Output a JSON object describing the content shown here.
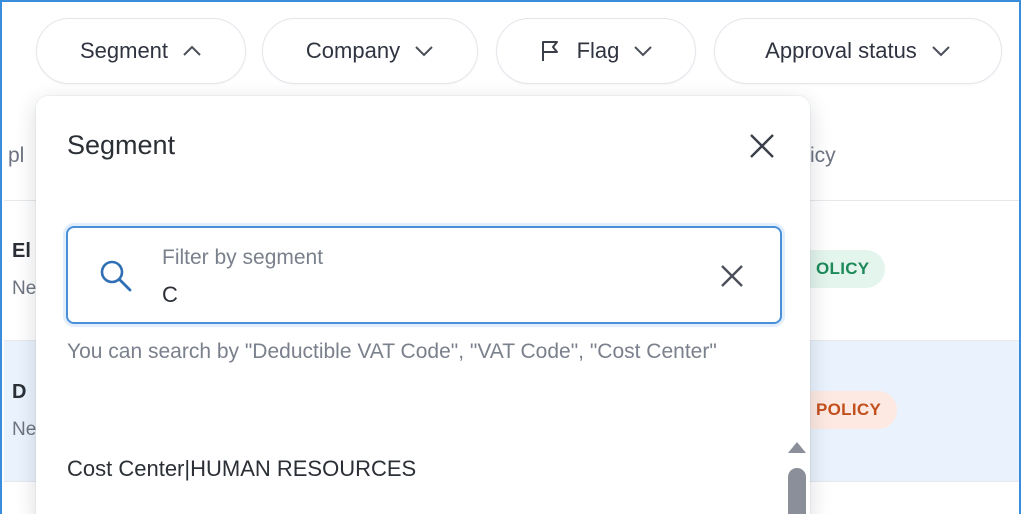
{
  "filters": {
    "segment": {
      "label": "Segment"
    },
    "company": {
      "label": "Company"
    },
    "flag": {
      "label": "Flag"
    },
    "approval": {
      "label": "Approval status"
    }
  },
  "table": {
    "header_left": "pl",
    "header_right": "icy",
    "rows": [
      {
        "title": "El",
        "subtitle": "Ne",
        "badge": "OLICY"
      },
      {
        "title": "D",
        "subtitle": "Ne",
        "badge": "POLICY"
      }
    ]
  },
  "panel": {
    "title": "Segment",
    "search_label": "Filter by segment",
    "search_value": "C",
    "hint": "You can search by \"Deductible VAT Code\", \"VAT Code\", \"Cost Center\"",
    "options": [
      "Cost Center|HUMAN RESOURCES"
    ]
  },
  "colors": {
    "focus": "#4a90d9",
    "in_policy": "#1d8a5a",
    "out_policy": "#c2501d",
    "selected_row": "#eaf3fd"
  },
  "icons": [
    "chevron-up-icon",
    "chevron-down-icon",
    "flag-icon",
    "close-icon",
    "search-icon",
    "clear-icon"
  ]
}
